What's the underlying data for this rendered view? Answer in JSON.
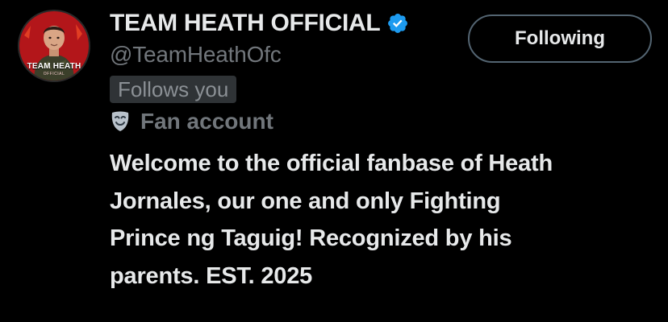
{
  "profile": {
    "display_name": "TEAM HEATH OFFICIAL",
    "handle": "@TeamHeathOfc",
    "follows_you": "Follows you",
    "fan_label": "Fan account",
    "avatar": {
      "title": "TEAM HEATH",
      "subtitle": "OFFICIAL"
    },
    "bio_lines": [
      "Welcome to the official fanbase of Heath",
      "Jornales, our one and only Fighting",
      "Prince ng Taguig! Recognized by his",
      "parents. EST. 2025"
    ]
  },
  "actions": {
    "follow_label": "Following"
  },
  "icons": {
    "verified": "verified-badge-icon",
    "fan": "theater-mask-icon"
  },
  "colors": {
    "background": "#000000",
    "primary_text": "#e7e9ea",
    "secondary_text": "#71767b",
    "verified": "#1d9bf0",
    "avatar_red": "#c8201f"
  }
}
